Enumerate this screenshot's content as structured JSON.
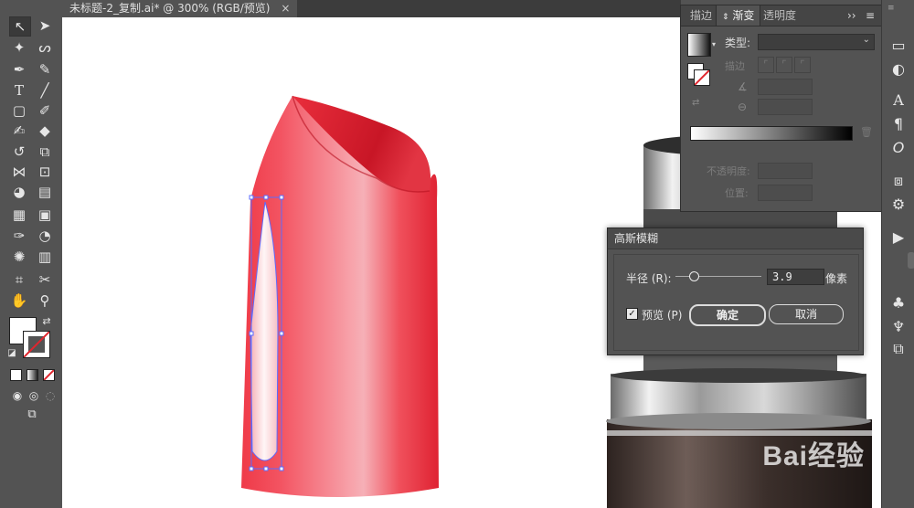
{
  "document": {
    "tab_title": "未标题-2_复制.ai* @ 300% (RGB/预览)",
    "close_symbol": "×"
  },
  "gradient_panel": {
    "tabs": [
      "描边",
      "渐变",
      "透明度"
    ],
    "active_tab": "渐变",
    "overflow_symbol": "››",
    "menu_symbol": "≡",
    "type_label": "类型:",
    "stroke_label": "描边",
    "opacity_label": "不透明度:",
    "position_label": "位置:"
  },
  "gaussian_blur": {
    "title": "高斯模糊",
    "radius_label": "半径 (R):",
    "radius_value": "3.9",
    "unit": "像素",
    "preview_label": "预览 (P)",
    "preview_checked": true,
    "ok_label": "确定",
    "cancel_label": "取消",
    "slider_fraction": 0.05
  },
  "watermark": {
    "text": "Bai经验"
  },
  "colors": {
    "lipstick_main": "#f0414f",
    "lipstick_dark": "#d21c2e",
    "selection": "#5b6bff",
    "ui_bg": "#535353"
  }
}
